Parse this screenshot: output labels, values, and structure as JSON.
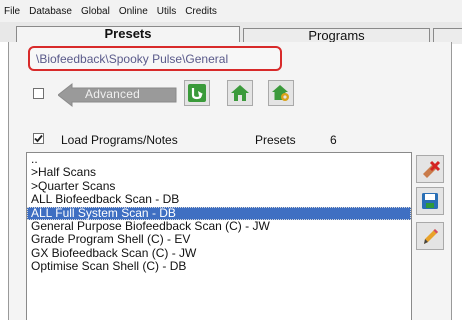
{
  "menu": [
    "File",
    "Database",
    "Global",
    "Online",
    "Utils",
    "Credits"
  ],
  "tabs": {
    "presets": "Presets",
    "programs": "Programs",
    "extra": ""
  },
  "path": "\\Biofeedback\\Spooky Pulse\\General",
  "advanced": {
    "label": "Advanced",
    "checked": false
  },
  "toolbar_icons": [
    "refresh-icon",
    "home-icon",
    "home-settings-icon"
  ],
  "load_programs": {
    "label": "Load Programs/Notes",
    "checked": true
  },
  "presets_label": "Presets",
  "presets_count": "6",
  "list_items": [
    "..",
    ">Half Scans",
    ">Quarter Scans",
    "ALL Biofeedback Scan - DB",
    "ALL Full System Scan - DB",
    "General Purpose Biofeedback Scan (C) - JW",
    "Grade Program Shell (C) - EV",
    "GX Biofeedback Scan (C) - JW",
    "Optimise Scan Shell (C) - DB"
  ],
  "selected_index": 4,
  "side_icons": [
    "delete-icon",
    "save-icon",
    "edit-icon"
  ],
  "colors": {
    "selection": "#3f6fc2",
    "highlight_border": "#d82a2a",
    "icon_green": "#2f9a3a"
  }
}
